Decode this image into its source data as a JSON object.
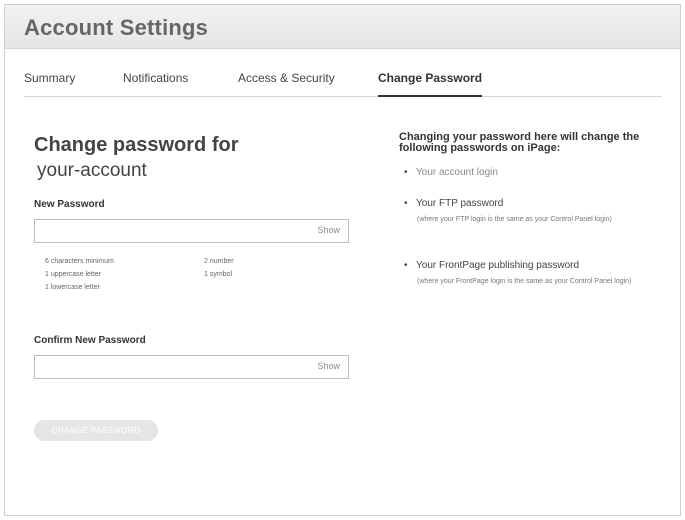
{
  "header": {
    "title": "Account Settings"
  },
  "tabs": [
    {
      "label": "Summary"
    },
    {
      "label": "Notifications"
    },
    {
      "label": "Access & Security"
    },
    {
      "label": "Change Password"
    }
  ],
  "form": {
    "title": "Change password for",
    "account_name": "your-account",
    "new_password_label": "New Password",
    "new_password_value": "",
    "show_label": "Show",
    "requirements": [
      "6 characters minimum",
      "1 uppercase letter",
      "1 lowercase letter",
      "2 number",
      "1 symbol"
    ],
    "confirm_label": "Confirm New Password",
    "confirm_value": "",
    "submit_label": "CHANGE PASSWORD"
  },
  "info": {
    "heading": "Changing your password here will change the following passwords on iPage:",
    "items": [
      {
        "label": "Your account login",
        "note": ""
      },
      {
        "label": "Your FTP password",
        "note": "(where your FTP login is the same as your Control Panel login)"
      },
      {
        "label": "Your FrontPage publishing password",
        "note": "(where your FrontPage login is the same as your Control Panel login)"
      }
    ]
  }
}
